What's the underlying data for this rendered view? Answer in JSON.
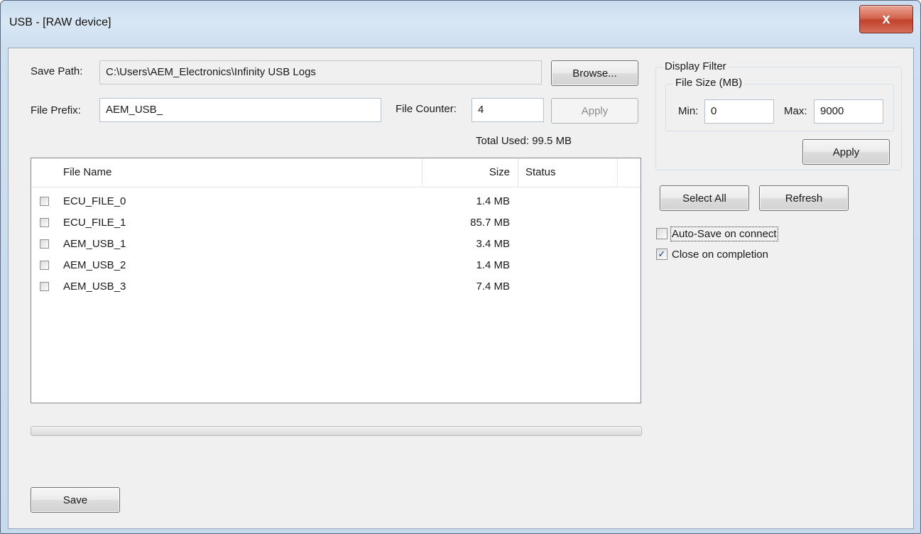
{
  "window": {
    "title": "USB - [RAW device]",
    "close_glyph": "x"
  },
  "save_path": {
    "label": "Save Path:",
    "value": "C:\\Users\\AEM_Electronics\\Infinity USB Logs",
    "browse_label": "Browse..."
  },
  "file_prefix": {
    "label": "File Prefix:",
    "value": "AEM_USB_"
  },
  "file_counter": {
    "label": "File Counter:",
    "value": "4",
    "apply_label": "Apply"
  },
  "total_used": "Total Used: 99.5 MB",
  "file_list": {
    "columns": [
      "File Name",
      "Size",
      "Status"
    ],
    "rows": [
      {
        "name": "ECU_FILE_0",
        "size": "1.4 MB",
        "status": "",
        "checked": false
      },
      {
        "name": "ECU_FILE_1",
        "size": "85.7 MB",
        "status": "",
        "checked": false
      },
      {
        "name": "AEM_USB_1",
        "size": "3.4 MB",
        "status": "",
        "checked": false
      },
      {
        "name": "AEM_USB_2",
        "size": "1.4 MB",
        "status": "",
        "checked": false
      },
      {
        "name": "AEM_USB_3",
        "size": "7.4 MB",
        "status": "",
        "checked": false
      }
    ]
  },
  "progress": {
    "value": 0
  },
  "save_label": "Save",
  "display_filter": {
    "title": "Display Filter",
    "file_size_title": "File Size (MB)",
    "min_label": "Min:",
    "min_value": "0",
    "max_label": "Max:",
    "max_value": "9000",
    "apply_label": "Apply"
  },
  "select_all_label": "Select All",
  "refresh_label": "Refresh",
  "options": {
    "auto_save": {
      "label": "Auto-Save on connect",
      "checked": false
    },
    "close_on_completion": {
      "label": "Close on completion",
      "checked": true,
      "check_glyph": "✓"
    }
  },
  "colors": {
    "title_gradient": "#c9dcef",
    "close_button": "#c2432c",
    "client_bg": "#f0f0f0",
    "progress_fill": "#06b025"
  }
}
